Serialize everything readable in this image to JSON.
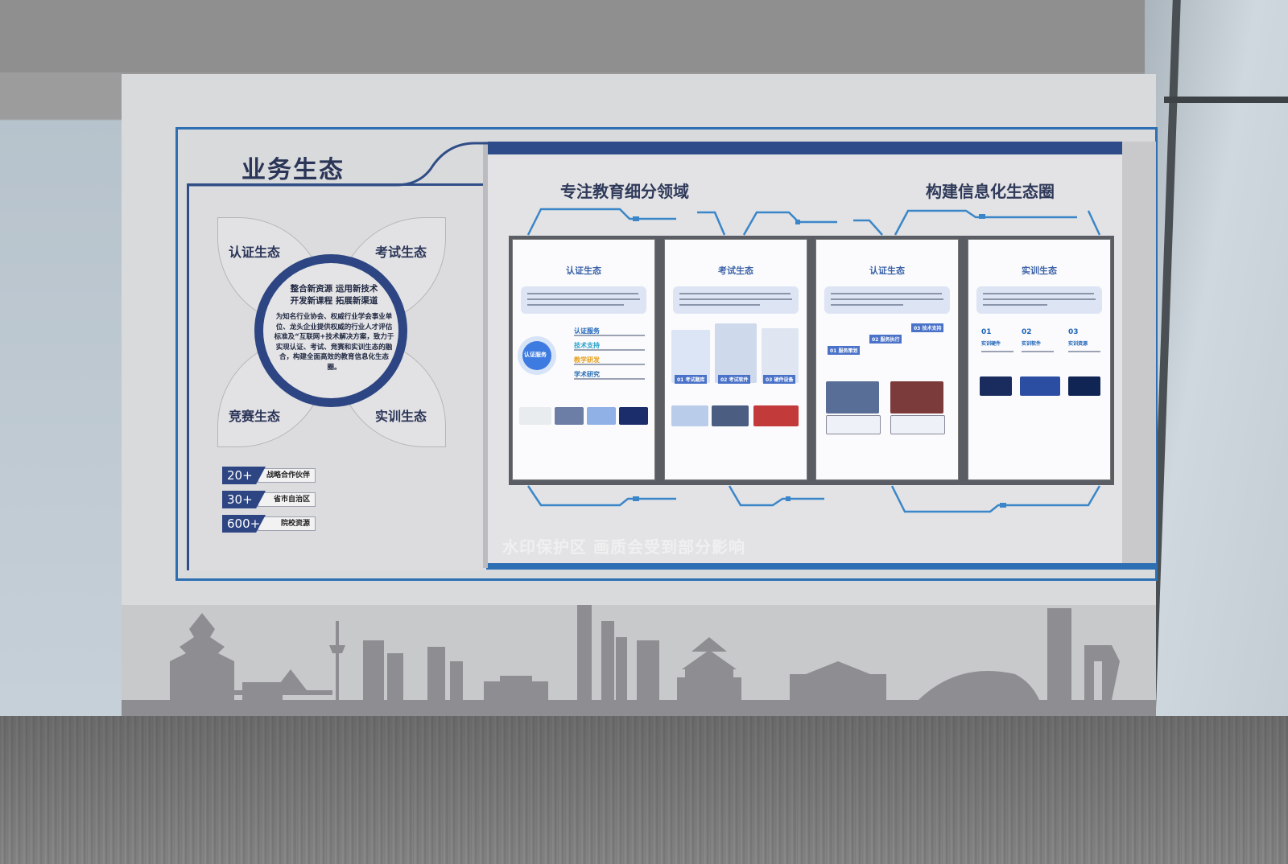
{
  "main_title": "业务生态",
  "subtitles": [
    "专注教育细分领域",
    "构建信息化生态圈"
  ],
  "petals": [
    "认证生态",
    "考试生态",
    "竞赛生态",
    "实训生态"
  ],
  "center": {
    "headline_1": "整合新资源 运用新技术",
    "headline_2": "开发新课程 拓展新渠道",
    "body": "为知名行业协会、权威行业学会事业单位、龙头企业提供权威的行业人才评估标准及“互联网+技术解决方案，致力于实现认证、考试、竞赛和实训生态的融合，构建全面高效的教育信息化生态圈。"
  },
  "stats": [
    {
      "num": "20+",
      "label": "战略合作伙伴"
    },
    {
      "num": "30+",
      "label": "省市自治区"
    },
    {
      "num": "600+",
      "label": "院校资源"
    }
  ],
  "cards": [
    {
      "title": "认证生态",
      "items": [
        "认证服务",
        "技术支持",
        "教学研发",
        "学术研究"
      ],
      "badge": "认证服务"
    },
    {
      "title": "考试生态",
      "items": [
        "01 考试题库",
        "02 考试软件",
        "03 硬件设备"
      ]
    },
    {
      "title": "认证生态",
      "items": [
        "01 服务策划",
        "02 服务执行",
        "03 技术支持"
      ]
    },
    {
      "title": "实训生态",
      "items": [
        "01",
        "02",
        "03"
      ],
      "sub": [
        "实训硬件",
        "实训软件",
        "实训资源"
      ]
    }
  ],
  "watermark": "水印保护区  画质会受到部分影响",
  "colors": {
    "navy": "#2d4582",
    "accent_blue": "#2d6fb2",
    "board": "#d9dadc"
  }
}
